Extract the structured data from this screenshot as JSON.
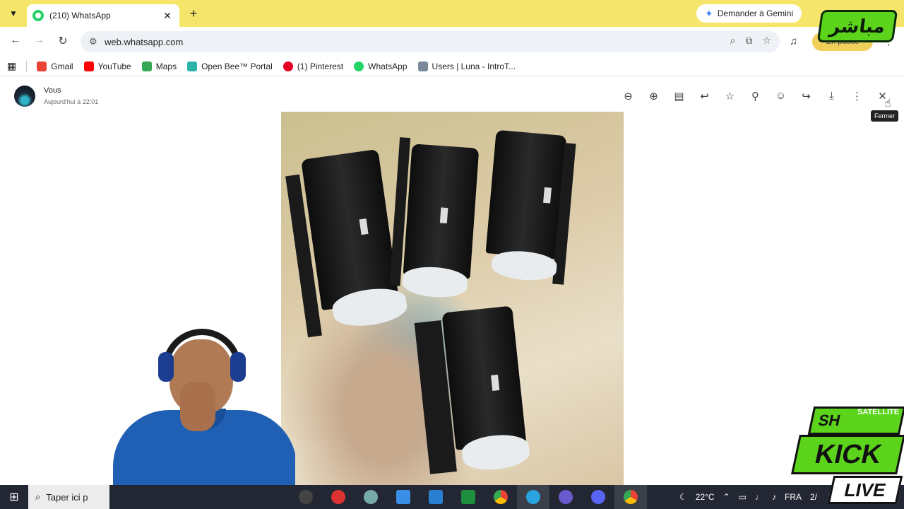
{
  "browser": {
    "tab_title": "(210) WhatsApp",
    "gemini_label": "Demander à Gemini",
    "url": "web.whatsapp.com",
    "pause_label": "En pause"
  },
  "bookmarks": [
    {
      "label": "Gmail",
      "color": "#ea4335"
    },
    {
      "label": "YouTube",
      "color": "#ff0000"
    },
    {
      "label": "Maps",
      "color": "#34a853"
    },
    {
      "label": "Open Bee™ Portal",
      "color": "#2bb3a8"
    },
    {
      "label": "(1) Pinterest",
      "color": "#e60023"
    },
    {
      "label": "WhatsApp",
      "color": "#25d366"
    },
    {
      "label": "Users | Luna - IntroT...",
      "color": "#7a8a9a"
    }
  ],
  "viewer": {
    "sender": "Vous",
    "timestamp": "Aujourd'hui à 22:01",
    "tooltip": "Fermer",
    "tools": [
      "zoom-out-icon",
      "zoom-in-icon",
      "caption-icon",
      "reply-icon",
      "star-icon",
      "pin-icon",
      "emoji-icon",
      "forward-icon",
      "download-icon",
      "more-icon",
      "close-icon"
    ]
  },
  "taskbar": {
    "search_placeholder": "Taper ici p",
    "temperature": "22°C",
    "language": "FRA",
    "clock_fragment": "2/"
  },
  "overlays": {
    "mubasher": "مباشر",
    "sh": "SH",
    "satellite": "SATELLITE",
    "kick": "KICK",
    "live": "LIVE"
  }
}
